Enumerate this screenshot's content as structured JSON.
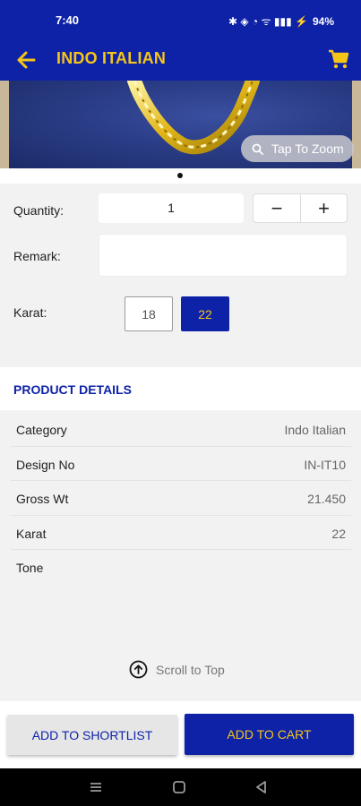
{
  "status_bar": {
    "time": "7:40",
    "icons": "✱ ◈ ◔ ᯤ ▮▮▮ ⚡",
    "battery": "94%"
  },
  "app_bar": {
    "title": "INDO ITALIAN",
    "back_icon": "arrow-left",
    "cart_icon": "cart"
  },
  "hero": {
    "zoom_label": "Tap To Zoom"
  },
  "form": {
    "quantity_label": "Quantity:",
    "quantity_value": "1",
    "minus": "−",
    "plus": "+",
    "remark_label": "Remark:",
    "remark_value": "",
    "karat_label": "Karat:",
    "karat_options": [
      "18",
      "22"
    ],
    "karat_selected": "22"
  },
  "product_details": {
    "heading": "PRODUCT DETAILS",
    "rows": [
      {
        "key": "Category",
        "value": "Indo Italian"
      },
      {
        "key": "Design No",
        "value": "IN-IT10"
      },
      {
        "key": "Gross Wt",
        "value": "21.450"
      },
      {
        "key": "Karat",
        "value": "22"
      },
      {
        "key": "Tone",
        "value": ""
      }
    ]
  },
  "scroll_to_top": "Scroll to Top",
  "actions": {
    "shortlist": "ADD TO SHORTLIST",
    "cart": "ADD TO CART"
  },
  "colors": {
    "primary": "#0e22a8",
    "accent": "#f5c518",
    "background": "#f2f2f2"
  }
}
